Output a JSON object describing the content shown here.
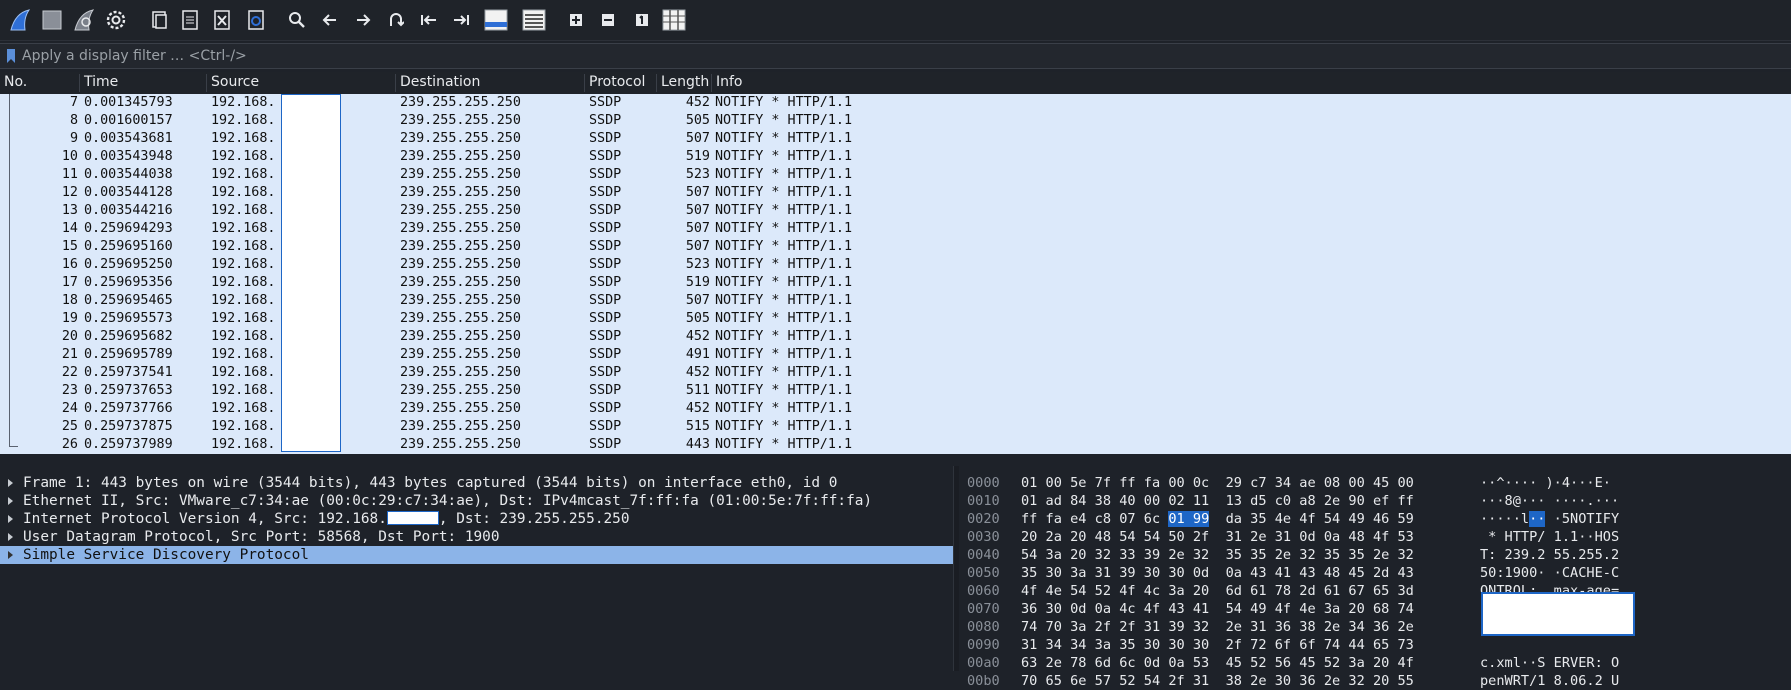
{
  "toolbar": {
    "icons": [
      "shark-fin-start-icon",
      "stop-square-icon",
      "restart-fin-icon",
      "gear-options-icon",
      "open-file-icon",
      "save-file-icon",
      "close-file-icon",
      "reload-file-icon",
      "search-icon",
      "go-back-icon",
      "go-forward-icon",
      "go-to-packet-icon",
      "go-first-icon",
      "go-last-icon",
      "autoscroll-icon",
      "colorize-icon",
      "zoom-in-icon",
      "zoom-out-icon",
      "normal-size-icon",
      "resize-columns-icon"
    ]
  },
  "filter": {
    "placeholder": "Apply a display filter … <Ctrl-/>"
  },
  "columns": {
    "no": "No.",
    "time": "Time",
    "source": "Source",
    "destination": "Destination",
    "protocol": "Protocol",
    "length": "Length",
    "info": "Info"
  },
  "packets": [
    {
      "no": "7",
      "time": "0.001345793",
      "src": "192.168.",
      "dst": "239.255.255.250",
      "proto": "SSDP",
      "len": "452",
      "info": "NOTIFY * HTTP/1.1"
    },
    {
      "no": "8",
      "time": "0.001600157",
      "src": "192.168.",
      "dst": "239.255.255.250",
      "proto": "SSDP",
      "len": "505",
      "info": "NOTIFY * HTTP/1.1"
    },
    {
      "no": "9",
      "time": "0.003543681",
      "src": "192.168.",
      "dst": "239.255.255.250",
      "proto": "SSDP",
      "len": "507",
      "info": "NOTIFY * HTTP/1.1"
    },
    {
      "no": "10",
      "time": "0.003543948",
      "src": "192.168.",
      "dst": "239.255.255.250",
      "proto": "SSDP",
      "len": "519",
      "info": "NOTIFY * HTTP/1.1"
    },
    {
      "no": "11",
      "time": "0.003544038",
      "src": "192.168.",
      "dst": "239.255.255.250",
      "proto": "SSDP",
      "len": "523",
      "info": "NOTIFY * HTTP/1.1"
    },
    {
      "no": "12",
      "time": "0.003544128",
      "src": "192.168.",
      "dst": "239.255.255.250",
      "proto": "SSDP",
      "len": "507",
      "info": "NOTIFY * HTTP/1.1"
    },
    {
      "no": "13",
      "time": "0.003544216",
      "src": "192.168.",
      "dst": "239.255.255.250",
      "proto": "SSDP",
      "len": "507",
      "info": "NOTIFY * HTTP/1.1"
    },
    {
      "no": "14",
      "time": "0.259694293",
      "src": "192.168.",
      "dst": "239.255.255.250",
      "proto": "SSDP",
      "len": "507",
      "info": "NOTIFY * HTTP/1.1"
    },
    {
      "no": "15",
      "time": "0.259695160",
      "src": "192.168.",
      "dst": "239.255.255.250",
      "proto": "SSDP",
      "len": "507",
      "info": "NOTIFY * HTTP/1.1"
    },
    {
      "no": "16",
      "time": "0.259695250",
      "src": "192.168.",
      "dst": "239.255.255.250",
      "proto": "SSDP",
      "len": "523",
      "info": "NOTIFY * HTTP/1.1"
    },
    {
      "no": "17",
      "time": "0.259695356",
      "src": "192.168.",
      "dst": "239.255.255.250",
      "proto": "SSDP",
      "len": "519",
      "info": "NOTIFY * HTTP/1.1"
    },
    {
      "no": "18",
      "time": "0.259695465",
      "src": "192.168.",
      "dst": "239.255.255.250",
      "proto": "SSDP",
      "len": "507",
      "info": "NOTIFY * HTTP/1.1"
    },
    {
      "no": "19",
      "time": "0.259695573",
      "src": "192.168.",
      "dst": "239.255.255.250",
      "proto": "SSDP",
      "len": "505",
      "info": "NOTIFY * HTTP/1.1"
    },
    {
      "no": "20",
      "time": "0.259695682",
      "src": "192.168.",
      "dst": "239.255.255.250",
      "proto": "SSDP",
      "len": "452",
      "info": "NOTIFY * HTTP/1.1"
    },
    {
      "no": "21",
      "time": "0.259695789",
      "src": "192.168.",
      "dst": "239.255.255.250",
      "proto": "SSDP",
      "len": "491",
      "info": "NOTIFY * HTTP/1.1"
    },
    {
      "no": "22",
      "time": "0.259737541",
      "src": "192.168.",
      "dst": "239.255.255.250",
      "proto": "SSDP",
      "len": "452",
      "info": "NOTIFY * HTTP/1.1"
    },
    {
      "no": "23",
      "time": "0.259737653",
      "src": "192.168.",
      "dst": "239.255.255.250",
      "proto": "SSDP",
      "len": "511",
      "info": "NOTIFY * HTTP/1.1"
    },
    {
      "no": "24",
      "time": "0.259737766",
      "src": "192.168.",
      "dst": "239.255.255.250",
      "proto": "SSDP",
      "len": "452",
      "info": "NOTIFY * HTTP/1.1"
    },
    {
      "no": "25",
      "time": "0.259737875",
      "src": "192.168.",
      "dst": "239.255.255.250",
      "proto": "SSDP",
      "len": "515",
      "info": "NOTIFY * HTTP/1.1"
    },
    {
      "no": "26",
      "time": "0.259737989",
      "src": "192.168.",
      "dst": "239.255.255.250",
      "proto": "SSDP",
      "len": "443",
      "info": "NOTIFY * HTTP/1.1"
    }
  ],
  "details": {
    "frame": "Frame 1: 443 bytes on wire (3544 bits), 443 bytes captured (3544 bits) on interface eth0, id 0",
    "ethernet": "Ethernet II, Src: VMware_c7:34:ae (00:0c:29:c7:34:ae), Dst: IPv4mcast_7f:ff:fa (01:00:5e:7f:ff:fa)",
    "ip_prefix": "Internet Protocol Version 4, Src: 192.168.",
    "ip_suffix": ", Dst: 239.255.255.250",
    "udp": "User Datagram Protocol, Src Port: 58568, Dst Port: 1900",
    "ssdp": "Simple Service Discovery Protocol"
  },
  "hex": [
    {
      "off": "0000",
      "b1": "01 00 5e 7f ff fa 00 0c",
      "b2": "29 c7 34 ae 08 00 45 00",
      "ascii": "··^···· )·4···E·"
    },
    {
      "off": "0010",
      "b1": "01 ad 84 38 40 00 02 11",
      "b2": "13 d5 c0 a8 2e 90 ef ff",
      "ascii": "···8@··· ····.···"
    },
    {
      "off": "0020",
      "b1a": "ff fa e4 c8 07 6c ",
      "b1hl": "01 99",
      "b2": "da 35 4e 4f 54 49 46 59",
      "ascii_a": "·····l",
      "ascii_hl": "··",
      "ascii_b": " ·5NOTIFY"
    },
    {
      "off": "0030",
      "b1": "20 2a 20 48 54 54 50 2f",
      "b2": "31 2e 31 0d 0a 48 4f 53",
      "ascii": " * HTTP/ 1.1··HOS"
    },
    {
      "off": "0040",
      "b1": "54 3a 20 32 33 39 2e 32",
      "b2": "35 35 2e 32 35 35 2e 32",
      "ascii": "T: 239.2 55.255.2"
    },
    {
      "off": "0050",
      "b1": "35 30 3a 31 39 30 30 0d",
      "b2": "0a 43 41 43 48 45 2d 43",
      "ascii": "50:1900· ·CACHE-C"
    },
    {
      "off": "0060",
      "b1": "4f 4e 54 52 4f 4c 3a 20",
      "b2": "6d 61 78 2d 61 67 65 3d",
      "ascii": "ONTROL:  max-age="
    },
    {
      "off": "0070",
      "b1": "36 30 0d 0a 4c 4f 43 41",
      "b2": "54 49 4f 4e 3a 20 68 74",
      "ascii": ""
    },
    {
      "off": "0080",
      "b1": "74 70 3a 2f 2f 31 39 32",
      "b2": "2e 31 36 38 2e 34 36 2e",
      "ascii": ""
    },
    {
      "off": "0090",
      "b1": "31 34 34 3a 35 30 30 30",
      "b2": "2f 72 6f 6f 74 44 65 73",
      "ascii": ""
    },
    {
      "off": "00a0",
      "b1": "63 2e 78 6d 6c 0d 0a 53",
      "b2": "45 52 56 45 52 3a 20 4f",
      "ascii": "c.xml··S ERVER: O"
    },
    {
      "off": "00b0",
      "b1": "70 65 6e 57 52 54 2f 31",
      "b2": "38 2e 30 36 2e 32 20 55",
      "ascii": "penWRT/1 8.06.2 U"
    }
  ],
  "colors": {
    "accent": "#1e66c6",
    "list_bg": "#dce9fa",
    "selected_detail": "#8cb4e8",
    "panel_bg": "#1e2229"
  }
}
